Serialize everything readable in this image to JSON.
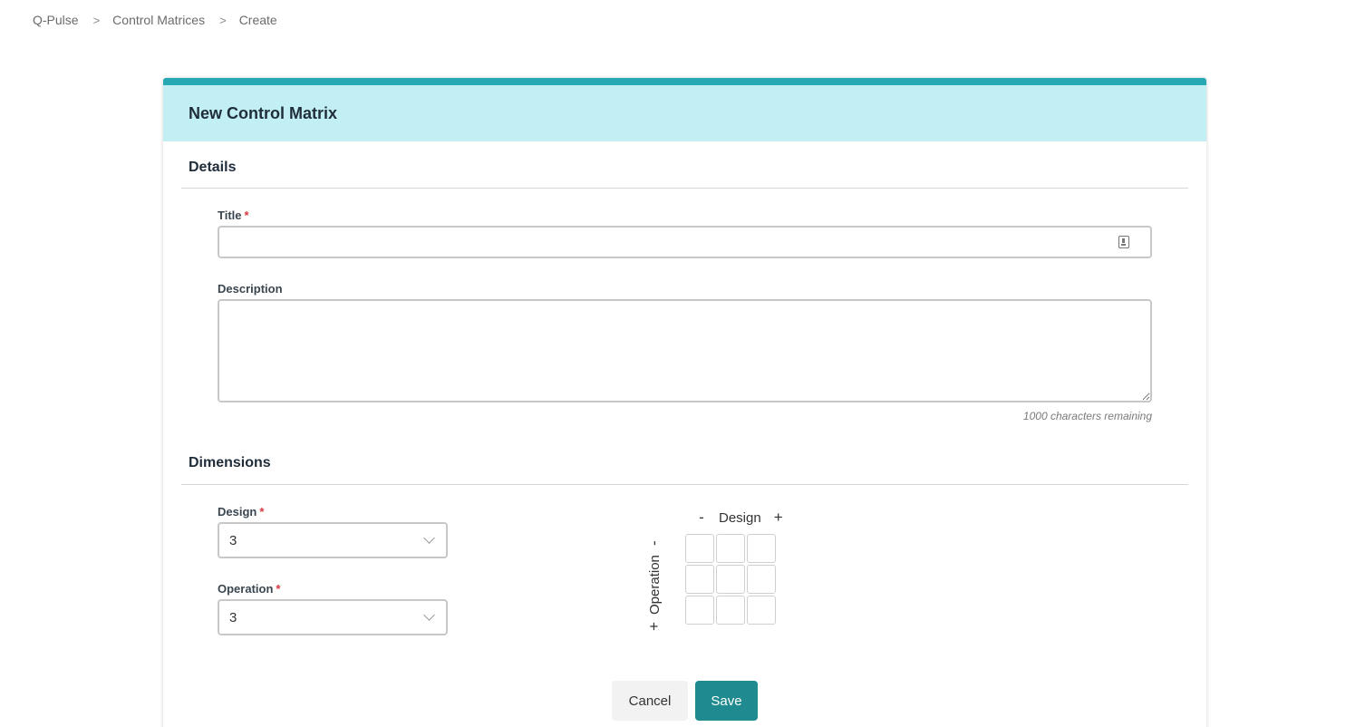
{
  "breadcrumb": {
    "items": [
      "Q-Pulse",
      "Control Matrices",
      "Create"
    ],
    "separator": ">"
  },
  "form": {
    "title": "New Control Matrix",
    "accent_color": "#26a9b3",
    "header_bg": "#c2eff3",
    "details": {
      "heading": "Details",
      "title_label": "Title",
      "title_value": "",
      "description_label": "Description",
      "description_value": "",
      "char_remaining": "1000 characters remaining"
    },
    "dimensions": {
      "heading": "Dimensions",
      "design_label": "Design",
      "design_value": "3",
      "operation_label": "Operation",
      "operation_value": "3"
    },
    "matrix": {
      "design_label": "Design",
      "operation_label": "Operation",
      "minus": "-",
      "plus": "+",
      "rows": 3,
      "cols": 3
    },
    "actions": {
      "cancel": "Cancel",
      "save": "Save"
    },
    "required_marker": "*"
  }
}
